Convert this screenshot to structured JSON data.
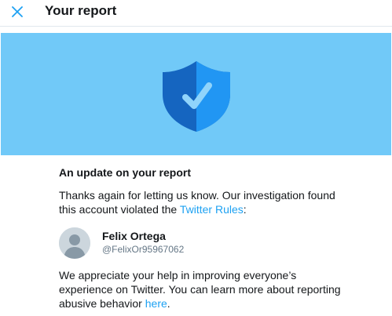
{
  "header": {
    "title": "Your report",
    "close_icon": "close-icon"
  },
  "hero": {
    "icon": "shield-check-icon",
    "background_color": "#71c9f8"
  },
  "report": {
    "heading": "An update on your report",
    "para1_prefix": "Thanks again for letting us know. Our investigation found this account violated the ",
    "rules_link": "Twitter Rules",
    "para1_suffix": ":",
    "account": {
      "name": "Felix Ortega",
      "handle": "@FelixOr95967062",
      "avatar_icon": "default-avatar-icon"
    },
    "para2_prefix": "We appreciate your help in improving everyone’s experience on Twitter. You can learn more about reporting abusive behavior ",
    "here_link": "here",
    "para2_suffix": "."
  },
  "colors": {
    "link": "#1da1f2",
    "shield_dark": "#1565c0",
    "shield_light": "#2196f3"
  }
}
